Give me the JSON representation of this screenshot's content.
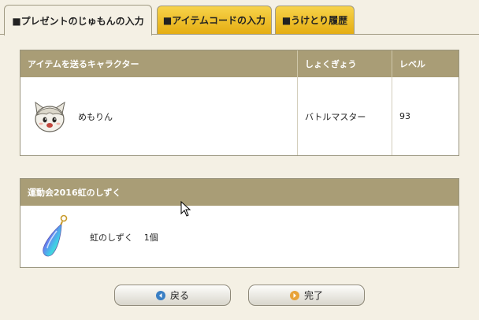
{
  "tabs": [
    {
      "label": "■プレゼントのじゅもんの入力",
      "active": true
    },
    {
      "label": "■アイテムコードの入力",
      "active": false
    },
    {
      "label": "■うけとり履歴",
      "active": false
    }
  ],
  "character_table": {
    "headers": [
      "アイテムを送るキャラクター",
      "しょくぎょう",
      "レベル"
    ],
    "row": {
      "name": "めもりん",
      "job": "バトルマスター",
      "level": "93",
      "avatar_icon": "cat-character-avatar-icon"
    }
  },
  "item_panel": {
    "title": "運動会2016虹のしずく",
    "item_name": "虹のしずく",
    "item_count": "1個",
    "item_icon": "rainbow-drop-pendant-icon"
  },
  "buttons": {
    "back_label": "戻る",
    "done_label": "完了",
    "back_icon": "left-arrow-circle-icon",
    "done_icon": "right-arrow-circle-icon"
  },
  "colors": {
    "header_bg": "#a99d76",
    "inactive_tab": "#efc22e",
    "page_bg": "#f4f0e4"
  }
}
